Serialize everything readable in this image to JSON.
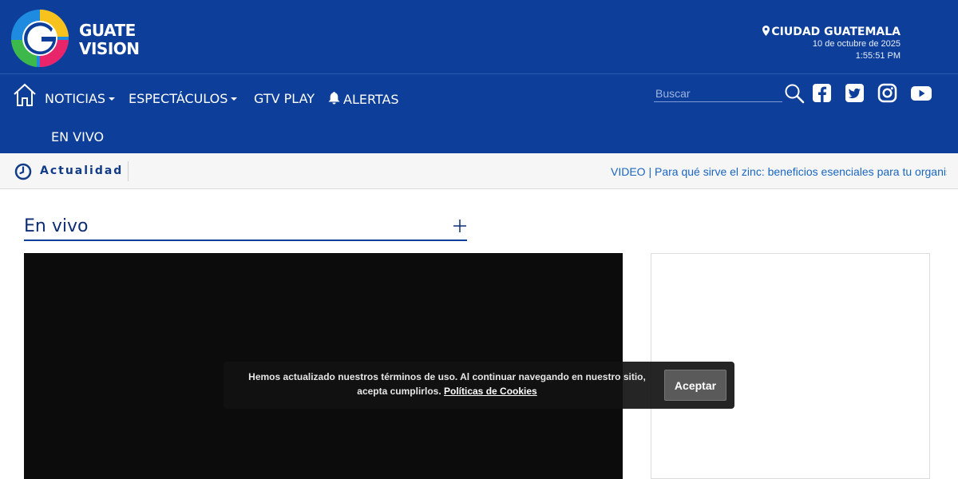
{
  "brand": {
    "name_line1": "GUATE",
    "name_line2": "VISION",
    "colors": {
      "primary": "#0d3f9a",
      "ticker_link": "#1a66c0",
      "heading": "#0d2e72"
    }
  },
  "location": {
    "city": "CIUDAD GUATEMALA",
    "date": "10 de octubre de 2025",
    "time": "1:55:51 PM"
  },
  "nav": {
    "items": [
      {
        "label": "NOTICIAS",
        "has_dropdown": true
      },
      {
        "label": "ESPECTÁCULOS",
        "has_dropdown": true
      },
      {
        "label": "GTV PLAY",
        "has_dropdown": false
      },
      {
        "label": "ALERTAS",
        "icon": "bell-icon"
      },
      {
        "label": "EN VIVO"
      }
    ],
    "search_placeholder": "Buscar",
    "social_icons": [
      "facebook-icon",
      "twitter-icon",
      "instagram-icon",
      "youtube-icon"
    ]
  },
  "ticker": {
    "label": "Actualidad",
    "headline": "VIDEO | Para qué sirve el zinc: beneficios esenciales para tu organismo"
  },
  "section": {
    "title": "En vivo"
  },
  "cookie_banner": {
    "message": "Hemos actualizado nuestros términos de uso. Al continuar navegando en nuestro sitio, acepta cumplirlos.",
    "link_label": "Políticas de Cookies",
    "accept_label": "Aceptar"
  }
}
